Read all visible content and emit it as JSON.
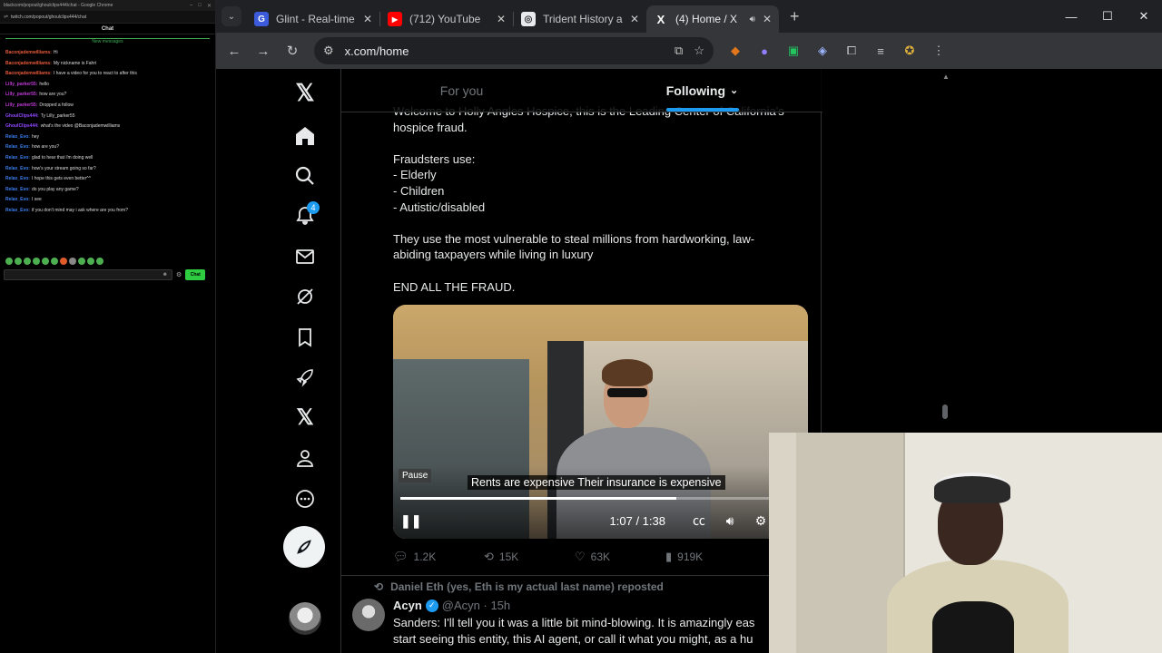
{
  "chat_window": {
    "titlebar": "blackcom/popout/ghoulclips444/chat - Google Chrome",
    "url": "twitch.com/popout/ghoulclips444/chat",
    "header": "Chat",
    "new_messages_label": "New messages",
    "messages": [
      {
        "user": "Baconjademwilliams:",
        "text": "Hi",
        "color": "#e85a3a"
      },
      {
        "user": "Baconjademwilliams:",
        "text": "My nickname is Fahri",
        "color": "#e85a3a"
      },
      {
        "user": "Baconjademwilliams:",
        "text": "I have a video for you to react to after this",
        "color": "#e85a3a"
      },
      {
        "user": "Lilly_parker55:",
        "text": "hello",
        "color": "#c03ad8"
      },
      {
        "user": "Lilly_parker55:",
        "text": "how are you?",
        "color": "#c03ad8"
      },
      {
        "user": "Lilly_parker55:",
        "text": "Dropped a follow",
        "color": "#c03ad8"
      },
      {
        "user": "GhoulClips444:",
        "text": "Ty Lilly_parker55",
        "color": "#9147ff"
      },
      {
        "user": "GhoulClips444:",
        "text": "what's the video @Baconjademwilliams",
        "color": "#9147ff"
      },
      {
        "user": "Relax_Evo:",
        "text": "hey",
        "color": "#3a7ff0"
      },
      {
        "user": "Relax_Evo:",
        "text": "how are you?",
        "color": "#3a7ff0"
      },
      {
        "user": "Relax_Evo:",
        "text": "glad to hear that i'm doing well",
        "color": "#3a7ff0"
      },
      {
        "user": "Relax_Evo:",
        "text": "how's your stream going so far?",
        "color": "#3a7ff0"
      },
      {
        "user": "Relax_Evo:",
        "text": "I hope this gets even better^^",
        "color": "#3a7ff0"
      },
      {
        "user": "Relax_Evo:",
        "text": "do you play any game?",
        "color": "#3a7ff0"
      },
      {
        "user": "Relax_Evo:",
        "text": "I see",
        "color": "#3a7ff0"
      },
      {
        "user": "Relax_Evo:",
        "text": "if you don't mind may i ask where are you from?",
        "color": "#3a7ff0"
      }
    ],
    "input_placeholder": "",
    "send_label": "Chat"
  },
  "browser": {
    "tabs": [
      {
        "title": "Glint - Real-time",
        "favicon_color": "#3b5bdb",
        "favicon": "G",
        "active": false
      },
      {
        "title": "(712) YouTube",
        "favicon_color": "#ff0000",
        "favicon": "▶",
        "active": false
      },
      {
        "title": "Trident History an",
        "favicon_color": "#9aa0a6",
        "favicon": "◎",
        "active": false
      },
      {
        "title": "(4) Home / X",
        "favicon_color": "#000000",
        "favicon": "X",
        "active": true
      }
    ],
    "url": "x.com/home"
  },
  "x": {
    "tabs": {
      "for_you": "For you",
      "following": "Following"
    },
    "notifications_badge": "4",
    "tweet_lines": [
      "Welcome to Holly Angles Hospice, this is the Leading Center of California's",
      "hospice fraud.",
      "",
      "Fraudsters use:",
      "- Elderly",
      "- Children",
      "- Autistic/disabled",
      "",
      "They use the most vulnerable to steal millions from hardworking, law-",
      "abiding taxpayers while living in luxury",
      "",
      "END ALL THE FRAUD."
    ],
    "video": {
      "pause_tooltip": "Pause",
      "caption": "Rents are expensive Their insurance is expensive",
      "time": "1:07 / 1:38",
      "progress": 0.69
    },
    "actions": {
      "replies": "1.2K",
      "reposts": "15K",
      "likes": "63K",
      "views": "919K"
    },
    "repost_banner": "Daniel Eth (yes, Eth is my actual last name) reposted",
    "next_tweet": {
      "name": "Acyn",
      "meta": "@Acyn · 15h",
      "lines": [
        "Sanders: I'll tell you it was a little bit mind-blowing. It is amazingly eas",
        "start seeing this entity, this AI agent, or call it what you might, as a hu"
      ]
    }
  }
}
